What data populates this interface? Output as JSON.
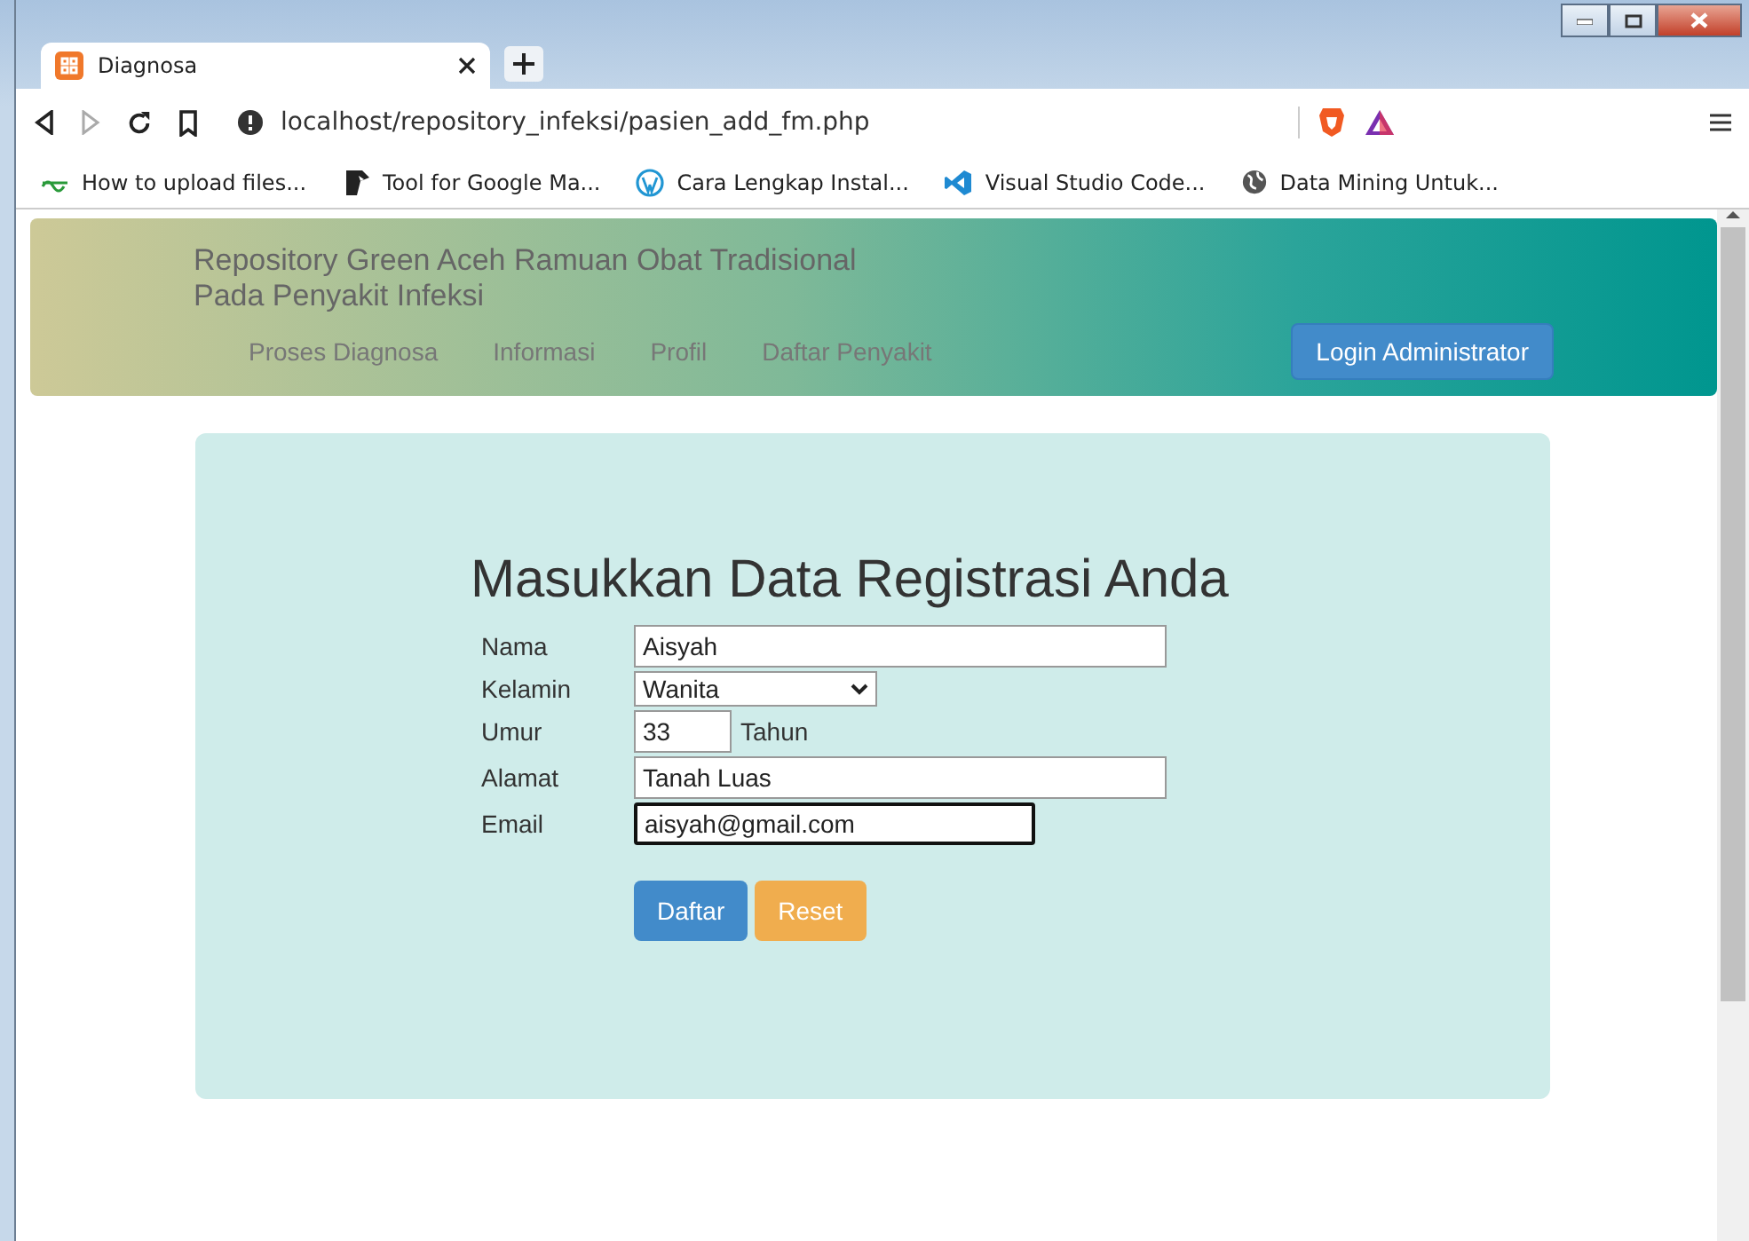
{
  "browser": {
    "tab": {
      "title": "Diagnosa",
      "selected": true
    },
    "address": "localhost/repository_infeksi/pasien_add_fm.php",
    "bookmarks": [
      {
        "label": "How to upload files...",
        "kind": "tilde"
      },
      {
        "label": "Tool for Google Ma...",
        "kind": "pen"
      },
      {
        "label": "Cara Lengkap Instal...",
        "kind": "wp"
      },
      {
        "label": "Visual Studio Code...",
        "kind": "vscode"
      },
      {
        "label": "Data Mining Untuk...",
        "kind": "globe"
      }
    ]
  },
  "header": {
    "title_lines": [
      "Repository Green Aceh Ramuan Obat Tradisional",
      "Pada Penyakit Infeksi"
    ],
    "nav": [
      "Proses Diagnosa",
      "Informasi",
      "Profil",
      "Daftar Penyakit"
    ],
    "login_button": "Login Administrator"
  },
  "form": {
    "heading": "Masukkan Data Registrasi Anda",
    "fields": [
      {
        "label": "Nama",
        "kind": "text",
        "value": "Aisyah",
        "focused": false
      },
      {
        "label": "Kelamin",
        "kind": "select",
        "value": "Wanita",
        "focused": false
      },
      {
        "label": "Umur",
        "kind": "number",
        "value": "33",
        "unit": "Tahun",
        "focused": false
      },
      {
        "label": "Alamat",
        "kind": "text",
        "value": "Tanah Luas",
        "focused": false
      },
      {
        "label": "Email",
        "kind": "email",
        "value": "aisyah@gmail.com",
        "focused": true
      }
    ],
    "buttons": [
      {
        "label": "Daftar",
        "kind": "primary"
      },
      {
        "label": "Reset",
        "kind": "warning"
      }
    ]
  }
}
